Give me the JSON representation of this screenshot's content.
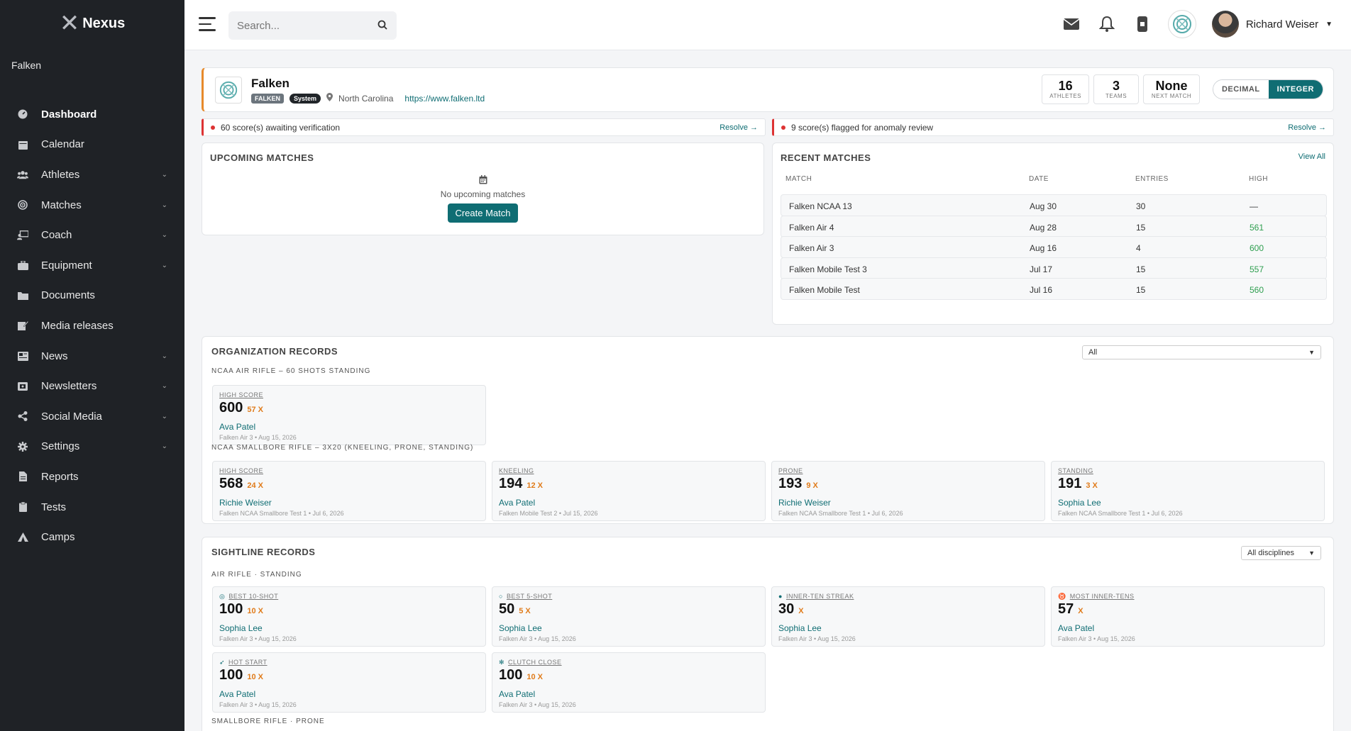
{
  "sidebar": {
    "brand": "Nexus",
    "org": "Falken",
    "items": [
      {
        "label": "Dashboard",
        "icon": "dashboard-icon",
        "active": true,
        "chevron": false
      },
      {
        "label": "Calendar",
        "icon": "calendar-icon",
        "chevron": false
      },
      {
        "label": "Athletes",
        "icon": "users-icon",
        "chevron": true
      },
      {
        "label": "Matches",
        "icon": "target-icon",
        "chevron": true
      },
      {
        "label": "Coach",
        "icon": "coach-icon",
        "chevron": true
      },
      {
        "label": "Equipment",
        "icon": "briefcase-icon",
        "chevron": true
      },
      {
        "label": "Documents",
        "icon": "folder-icon",
        "chevron": false
      },
      {
        "label": "Media releases",
        "icon": "edit-icon",
        "chevron": false
      },
      {
        "label": "News",
        "icon": "newspaper-icon",
        "chevron": true
      },
      {
        "label": "Newsletters",
        "icon": "envelope-icon",
        "chevron": true
      },
      {
        "label": "Social Media",
        "icon": "share-icon",
        "chevron": true
      },
      {
        "label": "Settings",
        "icon": "gear-icon",
        "chevron": true
      },
      {
        "label": "Reports",
        "icon": "file-icon",
        "chevron": false
      },
      {
        "label": "Tests",
        "icon": "clipboard-icon",
        "chevron": false
      },
      {
        "label": "Camps",
        "icon": "tent-icon",
        "chevron": false
      }
    ]
  },
  "topbar": {
    "search_placeholder": "Search...",
    "user_name": "Richard Weiser"
  },
  "org_header": {
    "name": "Falken",
    "tag": "FALKEN",
    "system_badge": "System",
    "location": "North Carolina",
    "website": "https://www.falken.ltd",
    "stats": [
      {
        "value": "16",
        "label": "ATHLETES"
      },
      {
        "value": "3",
        "label": "TEAMS"
      },
      {
        "value": "None",
        "label": "NEXT MATCH"
      }
    ],
    "toggle": {
      "decimal": "DECIMAL",
      "integer": "INTEGER",
      "selected": "INTEGER"
    }
  },
  "alerts": [
    {
      "text": "60 score(s) awaiting verification",
      "action": "Resolve →"
    },
    {
      "text": "9 score(s) flagged for anomaly review",
      "action": "Resolve →"
    }
  ],
  "upcoming": {
    "title": "UPCOMING MATCHES",
    "empty_text": "No upcoming matches",
    "button": "Create Match"
  },
  "recent": {
    "title": "RECENT MATCHES",
    "view_all": "View All",
    "columns": [
      "MATCH",
      "DATE",
      "ENTRIES",
      "HIGH"
    ],
    "rows": [
      {
        "match": "Falken NCAA 13",
        "date": "Aug 30",
        "entries": "30",
        "high": "—",
        "green": false
      },
      {
        "match": "Falken Air 4",
        "date": "Aug 28",
        "entries": "15",
        "high": "561",
        "green": true
      },
      {
        "match": "Falken Air 3",
        "date": "Aug 16",
        "entries": "4",
        "high": "600",
        "green": true
      },
      {
        "match": "Falken Mobile Test 3",
        "date": "Jul 17",
        "entries": "15",
        "high": "557",
        "green": true
      },
      {
        "match": "Falken Mobile Test",
        "date": "Jul 16",
        "entries": "15",
        "high": "560",
        "green": true
      }
    ]
  },
  "org_records": {
    "title": "ORGANIZATION RECORDS",
    "filter": "All",
    "groups": [
      {
        "label": "NCAA AIR RIFLE – 60 SHOTS STANDING",
        "cards": [
          {
            "label": "HIGH SCORE",
            "value": "600",
            "x": "57 X",
            "name": "Ava Patel",
            "meta": "Falken Air 3 • Aug 15, 2026"
          }
        ]
      },
      {
        "label": "NCAA SMALLBORE RIFLE – 3X20 (KNEELING, PRONE, STANDING)",
        "cards": [
          {
            "label": "HIGH SCORE",
            "value": "568",
            "x": "24 X",
            "name": "Richie Weiser",
            "meta": "Falken NCAA Smallbore Test 1 • Jul 6, 2026"
          },
          {
            "label": "KNEELING",
            "value": "194",
            "x": "12 X",
            "name": "Ava Patel",
            "meta": "Falken Mobile Test 2 • Jul 15, 2026"
          },
          {
            "label": "PRONE",
            "value": "193",
            "x": "9 X",
            "name": "Richie Weiser",
            "meta": "Falken NCAA Smallbore Test 1 • Jul 6, 2026"
          },
          {
            "label": "STANDING",
            "value": "191",
            "x": "3 X",
            "name": "Sophia Lee",
            "meta": "Falken NCAA Smallbore Test 1 • Jul 6, 2026"
          }
        ]
      }
    ]
  },
  "sightline": {
    "title": "SIGHTLINE RECORDS",
    "filter": "All disciplines",
    "group_label": "AIR RIFLE · STANDING",
    "next_group_label": "SMALLBORE RIFLE · PRONE",
    "cards": [
      {
        "label": "BEST 10-SHOT",
        "icon": "target-icon",
        "value": "100",
        "x": "10 X",
        "name": "Sophia Lee",
        "meta": "Falken Air 3 • Aug 15, 2026"
      },
      {
        "label": "BEST 5-SHOT",
        "icon": "circle-icon",
        "value": "50",
        "x": "5 X",
        "name": "Sophia Lee",
        "meta": "Falken Air 3 • Aug 15, 2026"
      },
      {
        "label": "INNER-TEN STREAK",
        "icon": "flame-icon",
        "value": "30",
        "x": "X",
        "name": "Sophia Lee",
        "meta": "Falken Air 3 • Aug 15, 2026"
      },
      {
        "label": "MOST INNER-TENS",
        "icon": "medal-icon",
        "value": "57",
        "x": "X",
        "name": "Ava Patel",
        "meta": "Falken Air 3 • Aug 15, 2026"
      },
      {
        "label": "HOT START",
        "icon": "rocket-icon",
        "value": "100",
        "x": "10 X",
        "name": "Ava Patel",
        "meta": "Falken Air 3 • Aug 15, 2026"
      },
      {
        "label": "CLUTCH CLOSE",
        "icon": "snowflake-icon",
        "value": "100",
        "x": "10 X",
        "name": "Ava Patel",
        "meta": "Falken Air 3 • Aug 15, 2026"
      }
    ]
  }
}
